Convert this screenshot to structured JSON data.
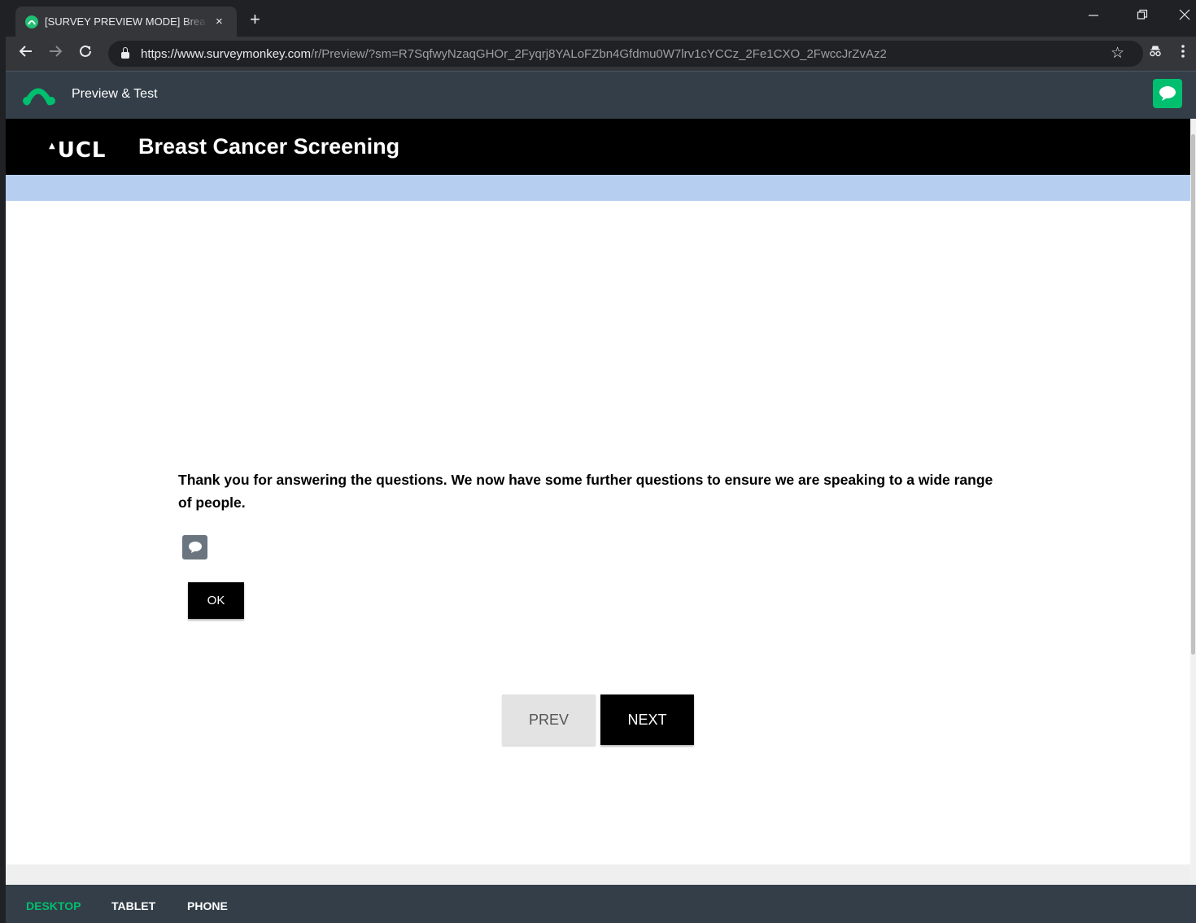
{
  "browser": {
    "tab_title": "[SURVEY PREVIEW MODE] Breast",
    "tab_close": "×",
    "new_tab": "+",
    "url_host": "https://www.surveymonkey.com",
    "url_path": "/r/Preview/?sm=R7SqfwyNzaqGHOr_2Fyqrj8YALoFZbn4Gfdmu0W7lrv1cYCCz_2Fe1CXO_2FwccJrZvAz2",
    "icons": [
      "back-icon",
      "forward-icon",
      "reload-icon",
      "lock-icon",
      "star-icon",
      "incognito-icon",
      "menu-icon",
      "minimize-icon",
      "restore-icon",
      "close-icon"
    ]
  },
  "preview_bar": {
    "title": "Preview & Test",
    "brand_color": "#00bf6f"
  },
  "survey": {
    "logo_text": "UCL",
    "title": "Breast Cancer Screening",
    "question_text": "Thank you for answering the questions. We now have some further questions to ensure we are speaking to a wide range of people.",
    "ok_label": "OK",
    "prev_label": "PREV",
    "next_label": "NEXT"
  },
  "device_bar": {
    "items": [
      {
        "label": "DESKTOP",
        "active": true
      },
      {
        "label": "TABLET",
        "active": false
      },
      {
        "label": "PHONE",
        "active": false
      }
    ]
  }
}
